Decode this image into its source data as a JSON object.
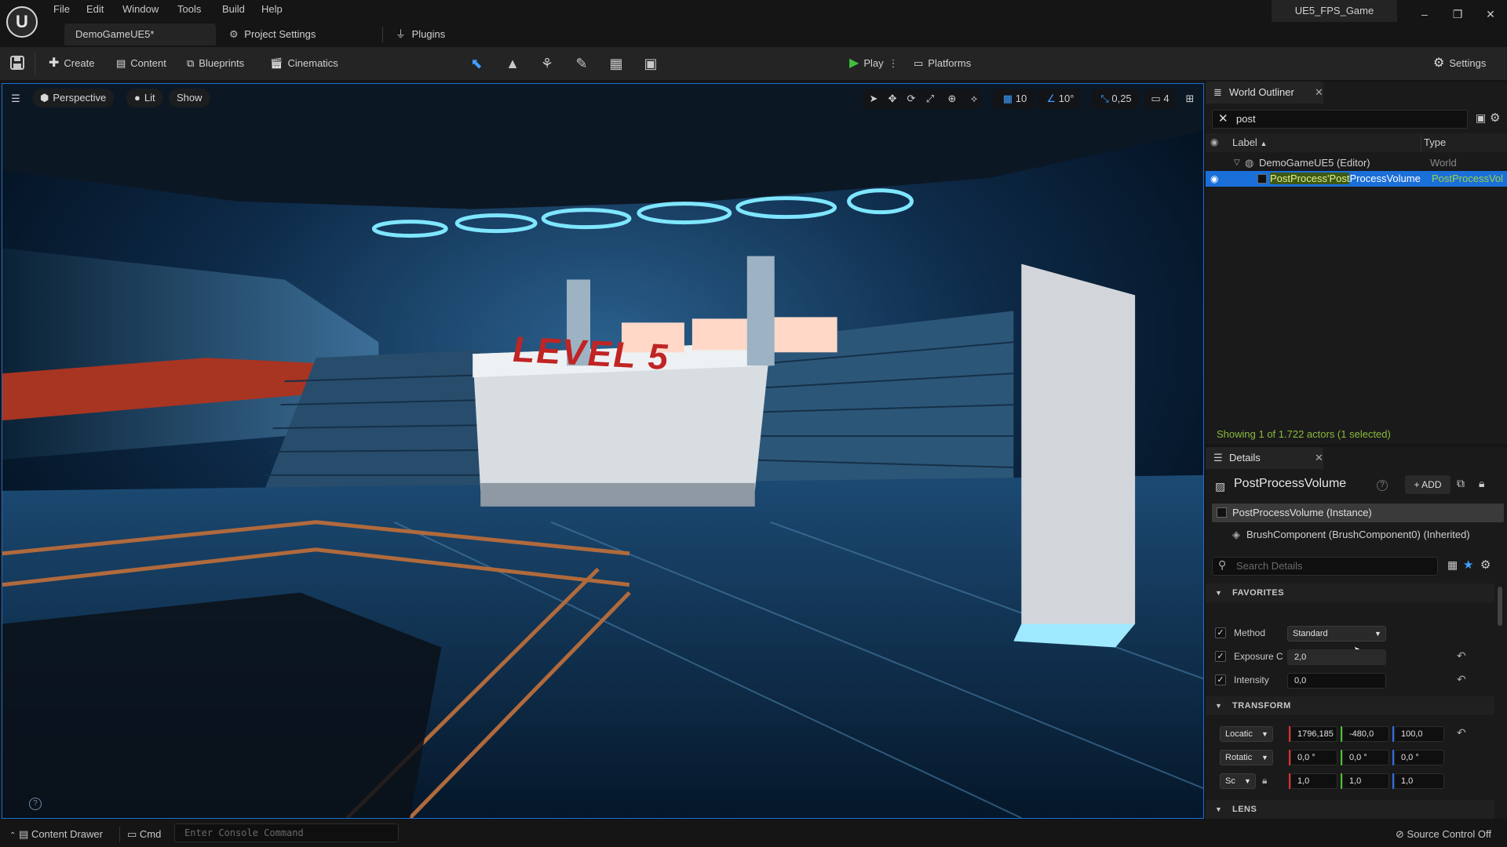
{
  "menu": {
    "items": [
      "File",
      "Edit",
      "Window",
      "Tools",
      "Build",
      "Help"
    ]
  },
  "tabs": {
    "level": "DemoGameUE5*",
    "project_settings": "Project Settings",
    "plugins": "Plugins"
  },
  "window": {
    "project_name": "UE5_FPS_Game"
  },
  "toolbar": {
    "create": "Create",
    "content": "Content",
    "blueprints": "Blueprints",
    "cinematics": "Cinematics",
    "play": "Play",
    "platforms": "Platforms",
    "settings": "Settings"
  },
  "viewport": {
    "perspective": "Perspective",
    "lit": "Lit",
    "show": "Show",
    "grid_snap": "10",
    "rotation_snap": "10°",
    "scale_snap": "0,25",
    "camera_speed": "4",
    "sign_text": "LEVEL 5"
  },
  "outliner": {
    "title": "World Outliner",
    "search_value": "post",
    "col_label": "Label",
    "col_type": "Type",
    "rows": [
      {
        "label": "DemoGameUE5 (Editor)",
        "type": "World"
      },
      {
        "label_pre": "PostProcess'",
        "label_match": "Post",
        "label_post": "ProcessVolume",
        "type": "PostProcessVol"
      }
    ],
    "status": "Showing 1 of 1.722 actors (1 selected)"
  },
  "details": {
    "title": "Details",
    "actor_name": "PostProcessVolume",
    "add_label": "ADD",
    "components": [
      "PostProcessVolume (Instance)",
      "BrushComponent (BrushComponent0) (Inherited)"
    ],
    "search_placeholder": "Search Details",
    "favorites": {
      "header": "FAVORITES",
      "method_label": "Method",
      "method_value": "Standard",
      "exposure_label": "Exposure C",
      "exposure_value": "2,0",
      "intensity_label": "Intensity",
      "intensity_value": "0,0"
    },
    "transform": {
      "header": "TRANSFORM",
      "location_label": "Locatic",
      "location": [
        "1796,185",
        "-480,0",
        "100,0"
      ],
      "rotation_label": "Rotatic",
      "rotation": [
        "0,0 °",
        "0,0 °",
        "0,0 °"
      ],
      "scale_label": "Sc",
      "scale": [
        "1,0",
        "1,0",
        "1,0"
      ]
    },
    "lens_header": "LENS"
  },
  "statusbar": {
    "content_drawer": "Content Drawer",
    "cmd": "Cmd",
    "console_placeholder": "Enter Console Command",
    "source_control": "Source Control Off"
  },
  "colors": {
    "accent_blue": "#1b6fd8",
    "play_green": "#3fbf3f",
    "search_match": "#c8e04a",
    "status_text": "#8ab93c",
    "axis_x": "#e03030",
    "axis_y": "#4cbf34",
    "axis_z": "#2f6fe0"
  }
}
